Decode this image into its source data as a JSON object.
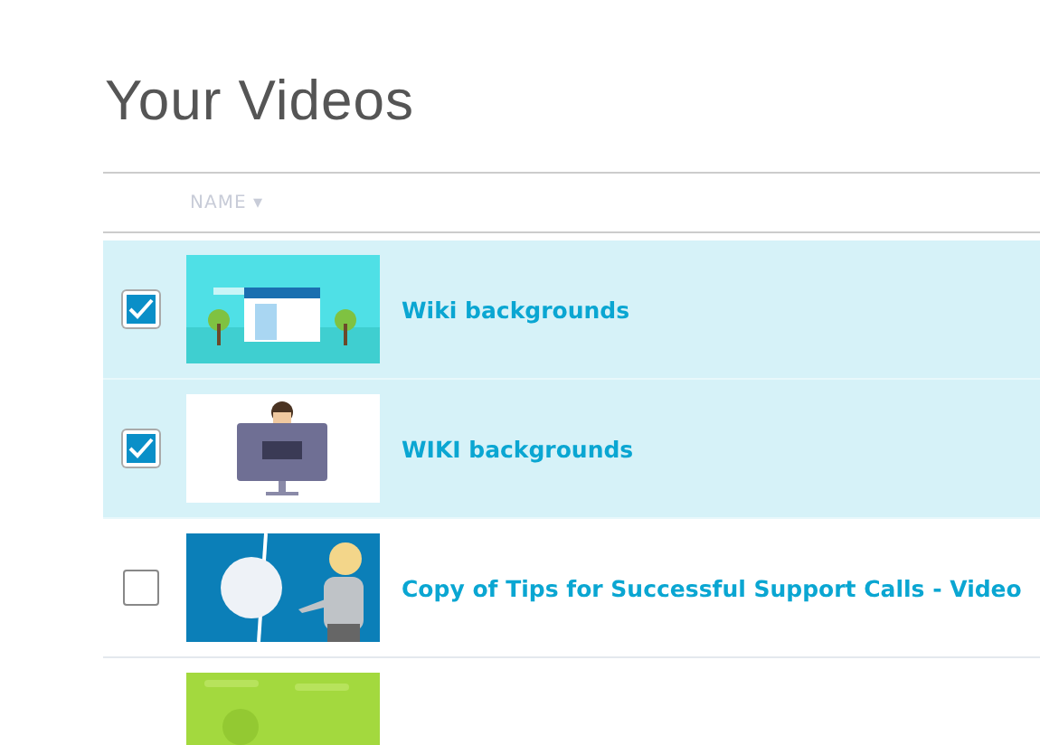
{
  "page": {
    "title": "Your Videos"
  },
  "table": {
    "columns": [
      {
        "label": "NAME",
        "sort": "▾"
      }
    ],
    "rows": [
      {
        "title": "Wiki backgrounds",
        "selected": true
      },
      {
        "title": "WIKI backgrounds",
        "selected": true
      },
      {
        "title": "Copy of Tips for Successful Support Calls - Video",
        "selected": false
      },
      {
        "selected": false
      }
    ]
  }
}
